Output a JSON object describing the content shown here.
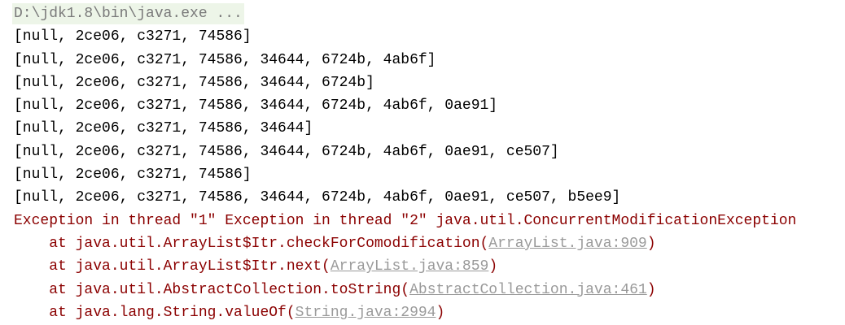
{
  "console": {
    "command": "D:\\jdk1.8\\bin\\java.exe ...",
    "output_lines": [
      "[null, 2ce06, c3271, 74586]",
      "[null, 2ce06, c3271, 74586, 34644, 6724b, 4ab6f]",
      "[null, 2ce06, c3271, 74586, 34644, 6724b]",
      "[null, 2ce06, c3271, 74586, 34644, 6724b, 4ab6f, 0ae91]",
      "[null, 2ce06, c3271, 74586, 34644]",
      "[null, 2ce06, c3271, 74586, 34644, 6724b, 4ab6f, 0ae91, ce507]",
      "[null, 2ce06, c3271, 74586]",
      "[null, 2ce06, c3271, 74586, 34644, 6724b, 4ab6f, 0ae91, ce507, b5ee9]"
    ],
    "exception": "Exception in thread \"1\" Exception in thread \"2\" java.util.ConcurrentModificationException",
    "stack": [
      {
        "prefix": "    at java.util.ArrayList$Itr.checkForComodification(",
        "link": "ArrayList.java:909",
        "suffix": ")"
      },
      {
        "prefix": "    at java.util.ArrayList$Itr.next(",
        "link": "ArrayList.java:859",
        "suffix": ")"
      },
      {
        "prefix": "    at java.util.AbstractCollection.toString(",
        "link": "AbstractCollection.java:461",
        "suffix": ")"
      },
      {
        "prefix": "    at java.lang.String.valueOf(",
        "link": "String.java:2994",
        "suffix": ")"
      }
    ],
    "colors": {
      "error": "#8b0000",
      "link": "#9a9a9a",
      "command_bg": "#edf5e8"
    }
  }
}
